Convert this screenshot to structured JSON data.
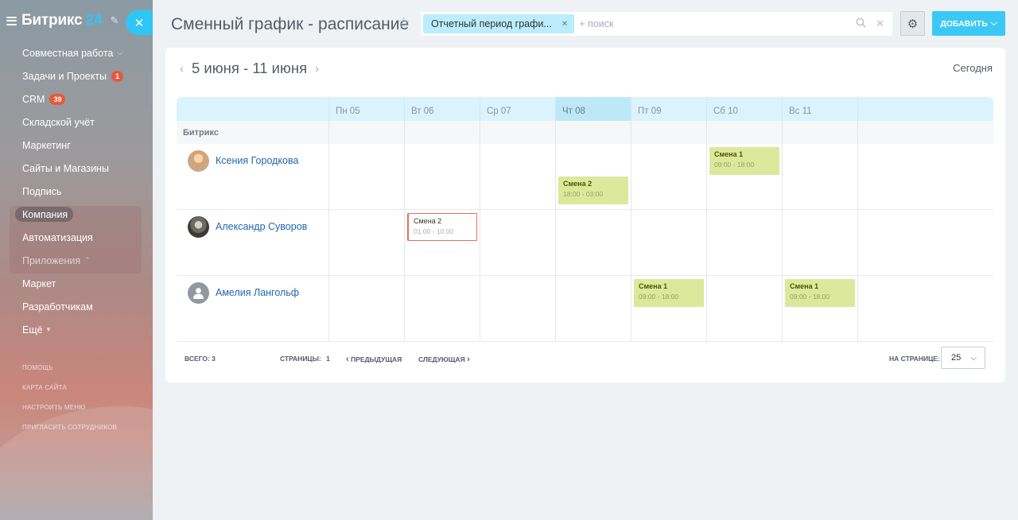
{
  "sidebar": {
    "logo_text": "Битрикс",
    "logo_num": "24",
    "items": [
      {
        "label": "Совместная работа"
      },
      {
        "label": "Задачи и Проекты",
        "badge": "1"
      },
      {
        "label": "CRM",
        "badge": "39"
      },
      {
        "label": "Складской учёт"
      },
      {
        "label": "Маркетинг"
      },
      {
        "label": "Сайты и Магазины"
      },
      {
        "label": "Подпись"
      },
      {
        "label": "Компания"
      },
      {
        "label": "Автоматизация"
      },
      {
        "label": "Приложения"
      },
      {
        "label": "Маркет"
      },
      {
        "label": "Разработчикам"
      },
      {
        "label": "Ещё"
      }
    ],
    "bottom_links": [
      "Помощь",
      "Карта сайта",
      "Настроить меню",
      "Пригласить сотрудников"
    ]
  },
  "header": {
    "title": "Сменный график - расписание",
    "filter_chip": "Отчетный период графи...",
    "search_placeholder": "+ поиск",
    "add_label": "ДОБАВИТЬ"
  },
  "schedule": {
    "date_range": "5 июня - 11 июня",
    "today_label": "Сегодня",
    "days": [
      "Пн 05",
      "Вт 06",
      "Ср 07",
      "Чт 08",
      "Пт 09",
      "Сб 10",
      "Вс 11"
    ],
    "group_name": "Битрикс",
    "employees": [
      {
        "name": "Ксения Городкова"
      },
      {
        "name": "Александр Суворов"
      },
      {
        "name": "Амелия Лангольф"
      }
    ],
    "shifts": {
      "s1": {
        "name": "Смена 1",
        "time": "09:00 - 18:00"
      },
      "s2": {
        "name": "Смена 2",
        "time": "18:00 - 03:00"
      },
      "s3": {
        "name": "Смена 2",
        "time": "01:00 - 10:00"
      },
      "s4": {
        "name": "Смена 1",
        "time": "09:00 - 18:00"
      },
      "s5": {
        "name": "Смена 1",
        "time": "09:00 - 18:00"
      }
    }
  },
  "footer": {
    "total": "ВСЕГО: 3",
    "pages_label": "СТРАНИЦЫ:",
    "pages_value": "1",
    "prev": "ПРЕДЫДУЩАЯ",
    "next": "СЛЕДУЮЩАЯ",
    "per_page_label": "НА СТРАНИЦЕ:",
    "per_page_value": "25"
  }
}
